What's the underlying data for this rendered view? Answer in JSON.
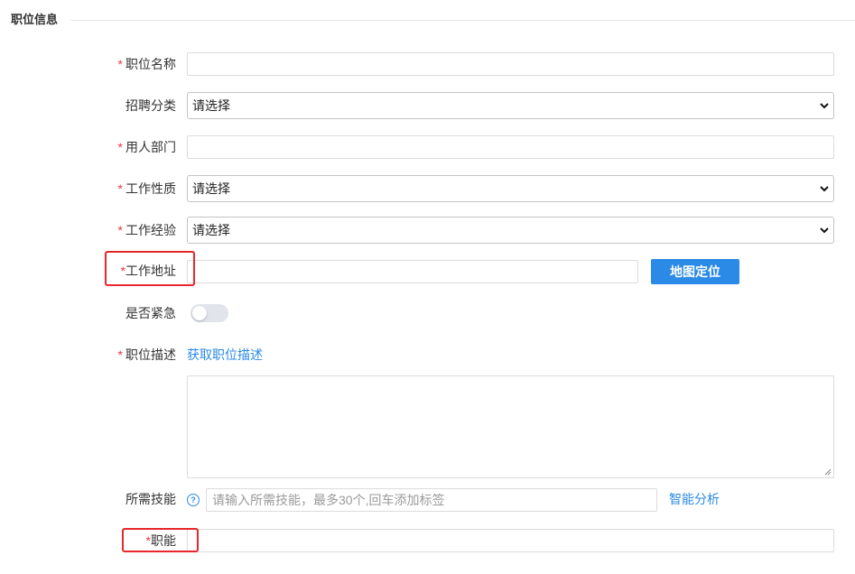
{
  "section": {
    "title": "职位信息"
  },
  "fields": {
    "job_name": {
      "required_mark": "*",
      "label": "职位名称",
      "value": ""
    },
    "category": {
      "label": "招聘分类",
      "selected": "请选择"
    },
    "department": {
      "required_mark": "*",
      "label": "用人部门",
      "value": ""
    },
    "job_nature": {
      "required_mark": "*",
      "label": "工作性质",
      "selected": "请选择"
    },
    "experience": {
      "required_mark": "*",
      "label": "工作经验",
      "selected": "请选择"
    },
    "address": {
      "required_mark": "*",
      "label": "工作地址",
      "value": "",
      "map_button": "地图定位"
    },
    "urgent": {
      "label": "是否紧急",
      "on": false
    },
    "description": {
      "required_mark": "*",
      "label": "职位描述",
      "link": "获取职位描述",
      "value": ""
    },
    "skills": {
      "label": "所需技能",
      "help": "?",
      "placeholder": "请输入所需技能，最多30个,回车添加标签",
      "action": "智能分析"
    },
    "function": {
      "required_mark": "*",
      "label": "职能",
      "value": ""
    }
  },
  "colors": {
    "accent": "#2a8ae6",
    "required": "#e4393c",
    "highlight_box": "#e8262b"
  }
}
